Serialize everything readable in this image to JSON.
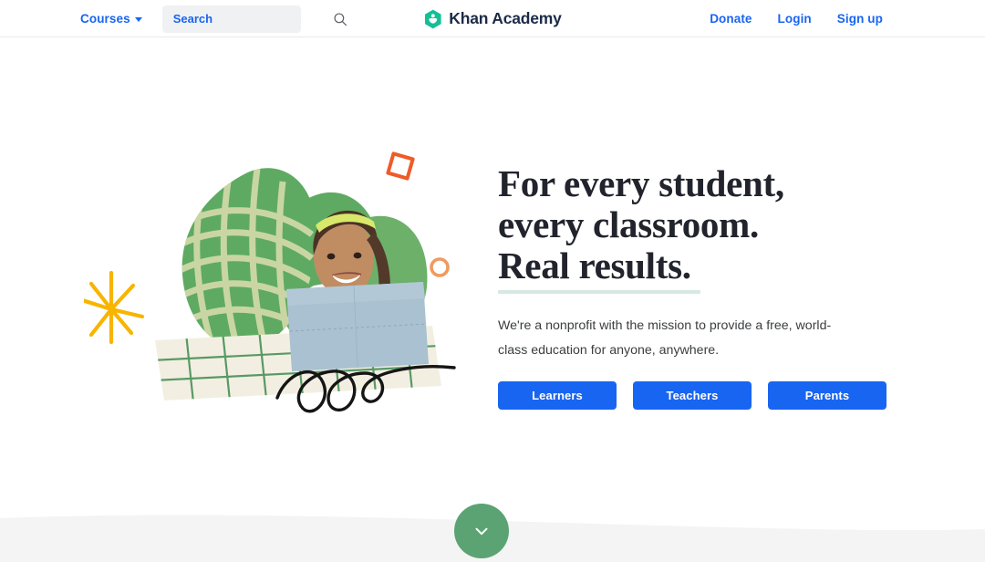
{
  "header": {
    "courses_label": "Courses",
    "courses_caret_icon": "chevron-down-icon",
    "search": {
      "placeholder": "Search",
      "value": "",
      "icon": "search-icon"
    },
    "brand": {
      "name": "Khan Academy",
      "logo_icon": "khan-academy-leaf-logo",
      "logo_color": "#14bf96",
      "text_color": "#1c2b47"
    },
    "links": [
      {
        "label": "Donate"
      },
      {
        "label": "Login"
      },
      {
        "label": "Sign up"
      }
    ],
    "link_color": "#1865f2"
  },
  "hero": {
    "headline": "For every student,\neveryclassroom.\nReal results.",
    "headline_lines": [
      "For every student,",
      "every classroom.",
      "Real results."
    ],
    "headline_color": "#21242c",
    "underline_color": "#d6e9e1",
    "subtitle": "We're a nonprofit with the mission to provide a free, world-class education for anyone, anywhere.",
    "buttons": [
      {
        "label": "Learners"
      },
      {
        "label": "Teachers"
      },
      {
        "label": "Parents"
      }
    ],
    "button_color": "#1865f2",
    "illustration": {
      "alt": "Smiling student working on a laptop at a grid-paper desk",
      "blob_color": "#5faa62",
      "blob_pattern_color": "#cfd9a8",
      "desk_paper_color": "#f2efe2",
      "desk_grid_color": "#3e8a4e",
      "laptop_screen_color": "#a9c1d1",
      "headband_color": "#d8e86a",
      "shirt_color": "#f6f7f8",
      "skin_color": "#c08d63",
      "hair_color": "#4b3225",
      "star_color": "#f7b500",
      "square_outline_color": "#ef5b28",
      "circle_outline_color": "#f09a5e",
      "scribble_color": "#151515"
    }
  },
  "lower": {
    "section_color": "#f4f4f4",
    "scroll_button": {
      "icon": "chevron-down-icon",
      "color": "#5ba373",
      "label": "Scroll down"
    }
  }
}
